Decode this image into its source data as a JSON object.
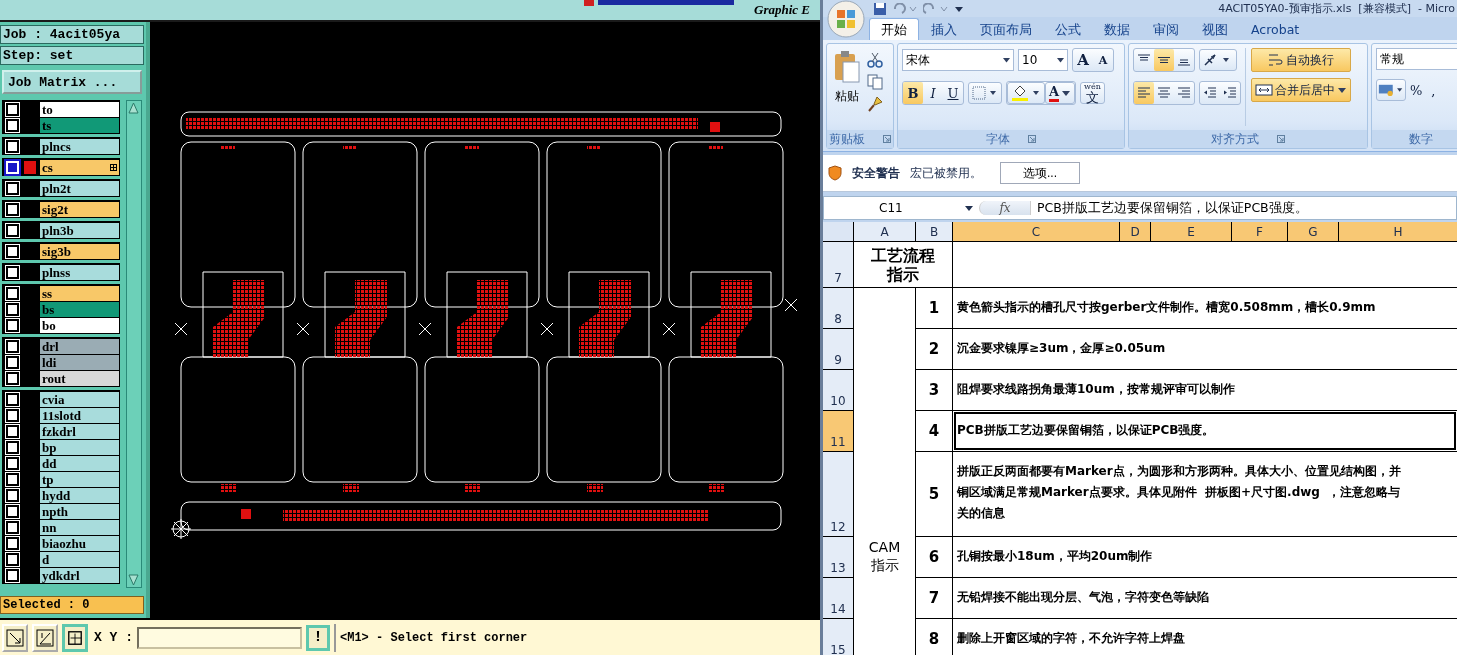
{
  "cam": {
    "brand_text": "Graphic E",
    "job": "Job : 4acit05ya",
    "step": "Step: set",
    "matrix_button": "Job Matrix ...",
    "layer_groups": [
      {
        "layers": [
          {
            "name": "to",
            "color": "#ffffff",
            "selected": false
          },
          {
            "name": "ts",
            "color": "#119977",
            "selected": false
          }
        ]
      },
      {
        "layers": [
          {
            "name": "plncs",
            "color": "#a8dcdc",
            "selected": false
          }
        ]
      },
      {
        "layers": [
          {
            "name": "cs",
            "color": "#f8c868",
            "selected": true
          }
        ]
      },
      {
        "layers": [
          {
            "name": "pln2t",
            "color": "#a8dcdc",
            "selected": false
          }
        ]
      },
      {
        "layers": [
          {
            "name": "sig2t",
            "color": "#f8c868",
            "selected": false
          }
        ]
      },
      {
        "layers": [
          {
            "name": "pln3b",
            "color": "#a8dcdc",
            "selected": false
          }
        ]
      },
      {
        "layers": [
          {
            "name": "sig3b",
            "color": "#f8c868",
            "selected": false
          }
        ]
      },
      {
        "layers": [
          {
            "name": "plnss",
            "color": "#a8dcdc",
            "selected": false
          }
        ]
      },
      {
        "layers": [
          {
            "name": "ss",
            "color": "#f8c868",
            "selected": false
          },
          {
            "name": "bs",
            "color": "#119977",
            "selected": false
          },
          {
            "name": "bo",
            "color": "#ffffff",
            "selected": false
          }
        ]
      },
      {
        "layers": [
          {
            "name": "drl",
            "color": "#9aacb4",
            "selected": false
          },
          {
            "name": "ldi",
            "color": "#9aacb4",
            "selected": false
          },
          {
            "name": "rout",
            "color": "#d8d8d8",
            "selected": false
          }
        ]
      },
      {
        "layers": [
          {
            "name": "cvia",
            "color": "#a8dcdc",
            "selected": false
          },
          {
            "name": "11slotd",
            "color": "#a8dcdc",
            "selected": false
          },
          {
            "name": "fzkdrl",
            "color": "#a8dcdc",
            "selected": false
          },
          {
            "name": "bp",
            "color": "#a8dcdc",
            "selected": false
          },
          {
            "name": "dd",
            "color": "#a8dcdc",
            "selected": false
          },
          {
            "name": "tp",
            "color": "#a8dcdc",
            "selected": false
          },
          {
            "name": "hydd",
            "color": "#a8dcdc",
            "selected": false
          },
          {
            "name": "npth",
            "color": "#a8dcdc",
            "selected": false
          },
          {
            "name": "nn",
            "color": "#a8dcdc",
            "selected": false
          },
          {
            "name": "biaozhu",
            "color": "#a8dcdc",
            "selected": false
          },
          {
            "name": "d",
            "color": "#a8dcdc",
            "selected": false
          },
          {
            "name": "ydkdrl",
            "color": "#a8dcdc",
            "selected": false
          }
        ]
      }
    ],
    "selected_count": "Selected : 0",
    "coord_label": "X Y :",
    "alert_button": "!",
    "prompt": "<M1> - Select first corner"
  },
  "excel": {
    "title": "4ACIT05YA0-预审指示.xls  [兼容模式]  - Micro",
    "tabs": [
      {
        "label": "开始",
        "selected": true
      },
      {
        "label": "插入",
        "selected": false
      },
      {
        "label": "页面布局",
        "selected": false
      },
      {
        "label": "公式",
        "selected": false
      },
      {
        "label": "数据",
        "selected": false
      },
      {
        "label": "审阅",
        "selected": false
      },
      {
        "label": "视图",
        "selected": false
      },
      {
        "label": "Acrobat",
        "selected": false
      }
    ],
    "clipboard": {
      "paste": "粘贴",
      "label": "剪贴板"
    },
    "font": {
      "label": "字体",
      "name": "宋体",
      "size": "10",
      "grow": "A",
      "shrink": "A",
      "color_button": "A",
      "phonetic_top": "wén",
      "phonetic_char": "文",
      "styles": [
        {
          "label": "B",
          "kind": "bold",
          "selected": true
        },
        {
          "label": "I",
          "kind": "italic",
          "selected": false
        },
        {
          "label": "U",
          "kind": "underline",
          "selected": false
        }
      ]
    },
    "alignment": {
      "label": "对齐方式",
      "vertical": [
        {
          "kind": "top",
          "selected": false
        },
        {
          "kind": "middle",
          "selected": true
        },
        {
          "kind": "bottom",
          "selected": false
        }
      ],
      "horizontal": [
        {
          "kind": "left",
          "selected": true
        },
        {
          "kind": "center",
          "selected": false
        },
        {
          "kind": "right",
          "selected": false
        }
      ],
      "wrap": {
        "label": "自动换行",
        "selected": true
      },
      "merge": {
        "label": "合并后居中",
        "selected": true
      }
    },
    "number": {
      "label": "数字",
      "format": "常规",
      "percent": "%",
      "comma": ","
    },
    "security": {
      "title": "安全警告",
      "message": "宏已被禁用。",
      "button": "选项..."
    },
    "formula_bar": {
      "cell": "C11",
      "function_label": "fx",
      "value": "PCB拼版工艺边要保留铜箔，以保证PCB强度。"
    },
    "columns": [
      {
        "label": "A",
        "selected": false
      },
      {
        "label": "B",
        "selected": false
      },
      {
        "label": "C",
        "selected": true
      },
      {
        "label": "D",
        "selected": true
      },
      {
        "label": "E",
        "selected": true
      },
      {
        "label": "F",
        "selected": true
      },
      {
        "label": "G",
        "selected": true
      },
      {
        "label": "H",
        "selected": true
      }
    ],
    "title_row": {
      "number": "7",
      "selected": false,
      "text": "工艺流程指示"
    },
    "group_label": "CAM\n指示",
    "rows": [
      {
        "number": "8",
        "selected": false,
        "step": "1",
        "lines": [
          "黄色箭头指示的槽孔尺寸按gerber文件制作。槽宽0.508mm，槽长0.9mm"
        ]
      },
      {
        "number": "9",
        "selected": false,
        "step": "2",
        "lines": [
          "沉金要求镍厚≥3um，金厚≥0.05um"
        ]
      },
      {
        "number": "10",
        "selected": false,
        "step": "3",
        "lines": [
          "阻焊要求线路拐角最薄10um，按常规评审可以制作"
        ]
      },
      {
        "number": "11",
        "selected": true,
        "step": "4",
        "lines": [
          "PCB拼版工艺边要保留铜箔，以保证PCB强度。"
        ]
      },
      {
        "number": "12",
        "selected": false,
        "step": "5",
        "lines": [
          "拼版正反两面都要有Marker点，为圆形和方形两种。具体大小、位置见结构图，并",
          "铜区域满足常规Marker点要求。具体见附件  拼板图+尺寸图.dwg  ，注意忽略与",
          "关的信息"
        ]
      },
      {
        "number": "13",
        "selected": false,
        "step": "6",
        "lines": [
          "孔铜按最小18um，平均20um制作"
        ]
      },
      {
        "number": "14",
        "selected": false,
        "step": "7",
        "lines": [
          "无铅焊接不能出现分层、气泡，字符变色等缺陷"
        ]
      },
      {
        "number": "15",
        "selected": false,
        "step": "8",
        "lines": [
          "删除上开窗区域的字符，不允许字符上焊盘"
        ]
      }
    ]
  }
}
